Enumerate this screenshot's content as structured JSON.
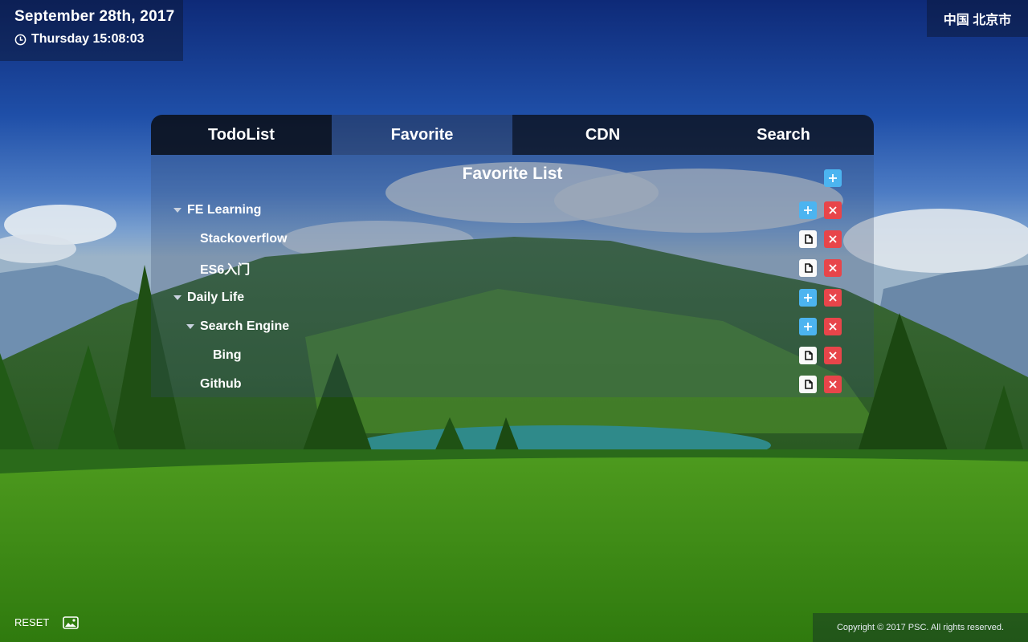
{
  "header": {
    "date": "September 28th, 2017",
    "time": "Thursday 15:08:03",
    "location": "中国 北京市"
  },
  "tabs": [
    {
      "label": "TodoList",
      "active": false
    },
    {
      "label": "Favorite",
      "active": true
    },
    {
      "label": "CDN",
      "active": false
    },
    {
      "label": "Search",
      "active": false
    }
  ],
  "favorite": {
    "title": "Favorite List",
    "items": [
      {
        "label": "FE Learning",
        "type": "folder",
        "level": 0,
        "expanded": true
      },
      {
        "label": "Stackoverflow",
        "type": "link",
        "level": 1
      },
      {
        "label": "ES6入门",
        "type": "link",
        "level": 1
      },
      {
        "label": "Daily Life",
        "type": "folder",
        "level": 0,
        "expanded": true
      },
      {
        "label": "Search Engine",
        "type": "folder",
        "level": 1,
        "expanded": true
      },
      {
        "label": "Bing",
        "type": "link",
        "level": 2
      },
      {
        "label": "Github",
        "type": "link",
        "level": 1
      }
    ]
  },
  "footer": {
    "reset_label": "RESET",
    "copyright": "Copyright © 2017 PSC. All rights reserved."
  },
  "icons": {
    "clock": "clock-icon",
    "add": "plus-icon",
    "delete": "close-icon",
    "open": "document-icon",
    "caret": "caret-down-icon",
    "image": "image-icon"
  },
  "colors": {
    "add_button": "#4cb4f0",
    "delete_button": "#e8454a",
    "open_button": "#fafafa"
  }
}
